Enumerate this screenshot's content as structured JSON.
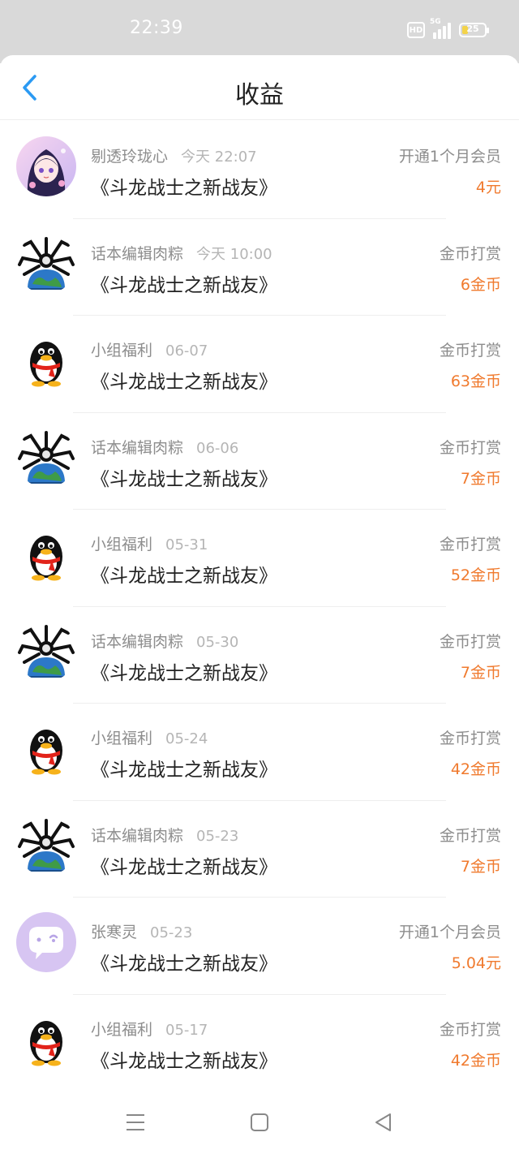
{
  "status_bar": {
    "time": "22:39",
    "hd": "HD",
    "network": "5G",
    "battery": "25",
    "battery_level": 0.25
  },
  "header": {
    "title": "收益",
    "back_icon": "chevron-left-icon"
  },
  "colors": {
    "accent": "#2b9af3",
    "amount": "#f07a2e",
    "status_bar_bg": "#d9d9d9"
  },
  "items": [
    {
      "user": "剔透玲珑心",
      "date": "今天 22:07",
      "title": "《斗龙战士之新战友》",
      "type": "开通1个月会员",
      "amount": "4元",
      "avatar": "anime-girl-avatar"
    },
    {
      "user": "话本编辑肉粽",
      "date": "今天 10:00",
      "title": "《斗龙战士之新战友》",
      "type": "金币打赏",
      "amount": "6金币",
      "avatar": "spider-globe-avatar"
    },
    {
      "user": "小组福利",
      "date": "06-07",
      "title": "《斗龙战士之新战友》",
      "type": "金币打赏",
      "amount": "63金币",
      "avatar": "penguin-avatar"
    },
    {
      "user": "话本编辑肉粽",
      "date": "06-06",
      "title": "《斗龙战士之新战友》",
      "type": "金币打赏",
      "amount": "7金币",
      "avatar": "spider-globe-avatar"
    },
    {
      "user": "小组福利",
      "date": "05-31",
      "title": "《斗龙战士之新战友》",
      "type": "金币打赏",
      "amount": "52金币",
      "avatar": "penguin-avatar"
    },
    {
      "user": "话本编辑肉粽",
      "date": "05-30",
      "title": "《斗龙战士之新战友》",
      "type": "金币打赏",
      "amount": "7金币",
      "avatar": "spider-globe-avatar"
    },
    {
      "user": "小组福利",
      "date": "05-24",
      "title": "《斗龙战士之新战友》",
      "type": "金币打赏",
      "amount": "42金币",
      "avatar": "penguin-avatar"
    },
    {
      "user": "话本编辑肉粽",
      "date": "05-23",
      "title": "《斗龙战士之新战友》",
      "type": "金币打赏",
      "amount": "7金币",
      "avatar": "spider-globe-avatar"
    },
    {
      "user": "张寒灵",
      "date": "05-23",
      "title": "《斗龙战士之新战友》",
      "type": "开通1个月会员",
      "amount": "5.04元",
      "avatar": "purple-chat-avatar"
    },
    {
      "user": "小组福利",
      "date": "05-17",
      "title": "《斗龙战士之新战友》",
      "type": "金币打赏",
      "amount": "42金币",
      "avatar": "penguin-avatar"
    }
  ],
  "bottom_nav": {
    "menu_icon": "menu-icon",
    "home_icon": "home-square-icon",
    "back_icon": "back-triangle-icon"
  }
}
